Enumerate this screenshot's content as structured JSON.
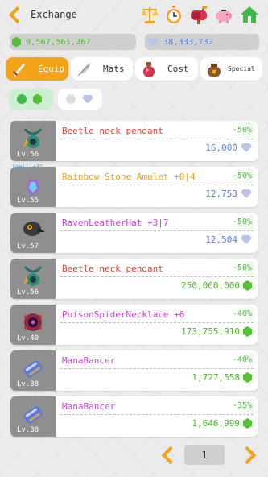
{
  "header": {
    "title": "Exchange",
    "icons": [
      "scale-icon",
      "stopwatch-icon",
      "mailbox-icon",
      "piggy-bank-icon",
      "home-icon"
    ]
  },
  "currency": {
    "green_gems": "9,567,561,267",
    "diamonds": "38,333,732"
  },
  "tabs": [
    {
      "label": "Equip",
      "icon": "dagger-icon",
      "active": true
    },
    {
      "label": "Mats",
      "icon": "feather-icon",
      "active": false
    },
    {
      "label": "Cost",
      "icon": "potion-icon",
      "active": false
    },
    {
      "label": "Special",
      "icon": "treasure-bag-icon",
      "active": false
    }
  ],
  "filters": [
    {
      "name": "green-gem-filter",
      "on": true
    },
    {
      "name": "diamond-filter",
      "on": false
    }
  ],
  "items": [
    {
      "name": "Beetle neck pendant",
      "level": "Lv.56",
      "pct": "-50%",
      "price": "16,000",
      "currency": "diamond",
      "name_color": "#e0413b",
      "price_color": "#5a7ad8",
      "icon": "pendant-icon",
      "enhance": ""
    },
    {
      "name": "Rainbow Stone Amulet +0|4",
      "level": "Lv.55",
      "pct": "-50%",
      "price": "12,753",
      "currency": "diamond",
      "name_color": "#f3a21a",
      "price_color": "#5a7ad8",
      "icon": "amulet-icon",
      "enhance": "Spell +37"
    },
    {
      "name": "RavenLeatherHat +3|7",
      "level": "Lv.57",
      "pct": "-50%",
      "price": "12,504",
      "currency": "diamond",
      "name_color": "#cc44d6",
      "price_color": "#5a7ad8",
      "icon": "raven-hat-icon",
      "enhance": ""
    },
    {
      "name": "Beetle neck pendant",
      "level": "Lv.56",
      "pct": "-50%",
      "price": "250,000,000",
      "currency": "green",
      "name_color": "#e0413b",
      "price_color": "#4cba2b",
      "icon": "pendant-icon",
      "enhance": ""
    },
    {
      "name": "PoisonSpiderNecklace +6",
      "level": "Lv.40",
      "pct": "-40%",
      "price": "173,755,910",
      "currency": "green",
      "name_color": "#cc44d6",
      "price_color": "#4cba2b",
      "icon": "spider-necklace-icon",
      "enhance": ""
    },
    {
      "name": "ManaBancer",
      "level": "Lv.38",
      "pct": "-40%",
      "price": "1,727,558",
      "currency": "green",
      "name_color": "#cc44d6",
      "price_color": "#4cba2b",
      "icon": "bracer-icon",
      "enhance": ""
    },
    {
      "name": "ManaBancer",
      "level": "Lv.38",
      "pct": "-35%",
      "price": "1,646,999",
      "currency": "green",
      "name_color": "#cc44d6",
      "price_color": "#4cba2b",
      "icon": "bracer-icon",
      "enhance": ""
    }
  ],
  "pager": {
    "page": "1"
  },
  "colors": {
    "accent": "#f3a21a",
    "green": "#4cba2b",
    "blue": "#5a7ad8",
    "pink": "#cc44d6",
    "red": "#e0413b"
  }
}
